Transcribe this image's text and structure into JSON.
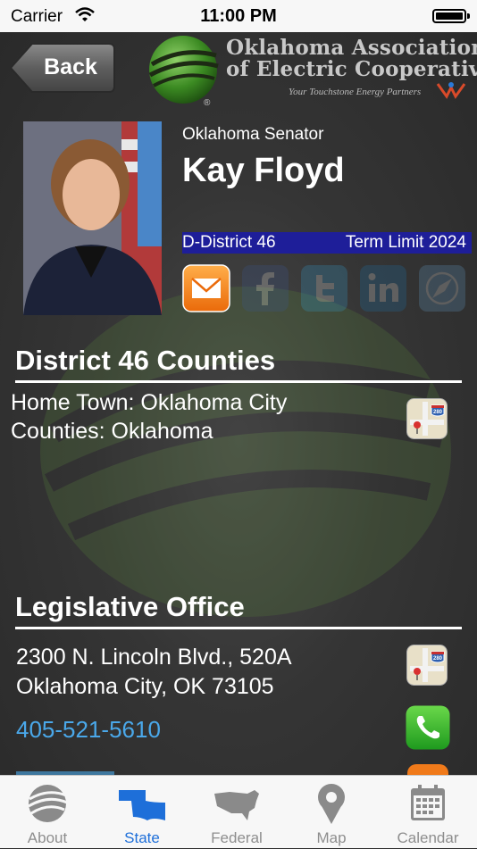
{
  "status_bar": {
    "carrier": "Carrier",
    "time": "11:00 PM"
  },
  "nav": {
    "back_label": "Back"
  },
  "header": {
    "org_line1": "Oklahoma Association",
    "org_line2": "of Electric Cooperatives",
    "tagline": "Your Touchstone Energy Partners",
    "registered_mark": "®"
  },
  "profile": {
    "title": "Oklahoma Senator",
    "name": "Kay Floyd",
    "district": "D-District 46",
    "term_limit": "Term Limit 2024",
    "social_icons": [
      "email-icon",
      "facebook-icon",
      "twitter-icon",
      "linkedin-icon",
      "web-icon"
    ]
  },
  "district_section": {
    "heading": "District 46 Counties",
    "home_town": "Home Town: Oklahoma City",
    "counties": "Counties: Oklahoma"
  },
  "office_section": {
    "heading": "Legislative Office",
    "address_line1": "2300 N. Lincoln Blvd., 520A",
    "address_line2": "Oklahoma City, OK 73105",
    "phone": "405-521-5610",
    "map_badge": "280"
  },
  "tabs": [
    {
      "label": "About",
      "icon": "globe-icon",
      "active": false
    },
    {
      "label": "State",
      "icon": "oklahoma-map-icon",
      "active": true
    },
    {
      "label": "Federal",
      "icon": "usa-map-icon",
      "active": false
    },
    {
      "label": "Map",
      "icon": "map-pin-icon",
      "active": false
    },
    {
      "label": "Calendar",
      "icon": "calendar-icon",
      "active": false
    }
  ],
  "colors": {
    "tab_active": "#1e6fd9",
    "link": "#4aa8ea",
    "district_bar": "#1e1e99"
  }
}
